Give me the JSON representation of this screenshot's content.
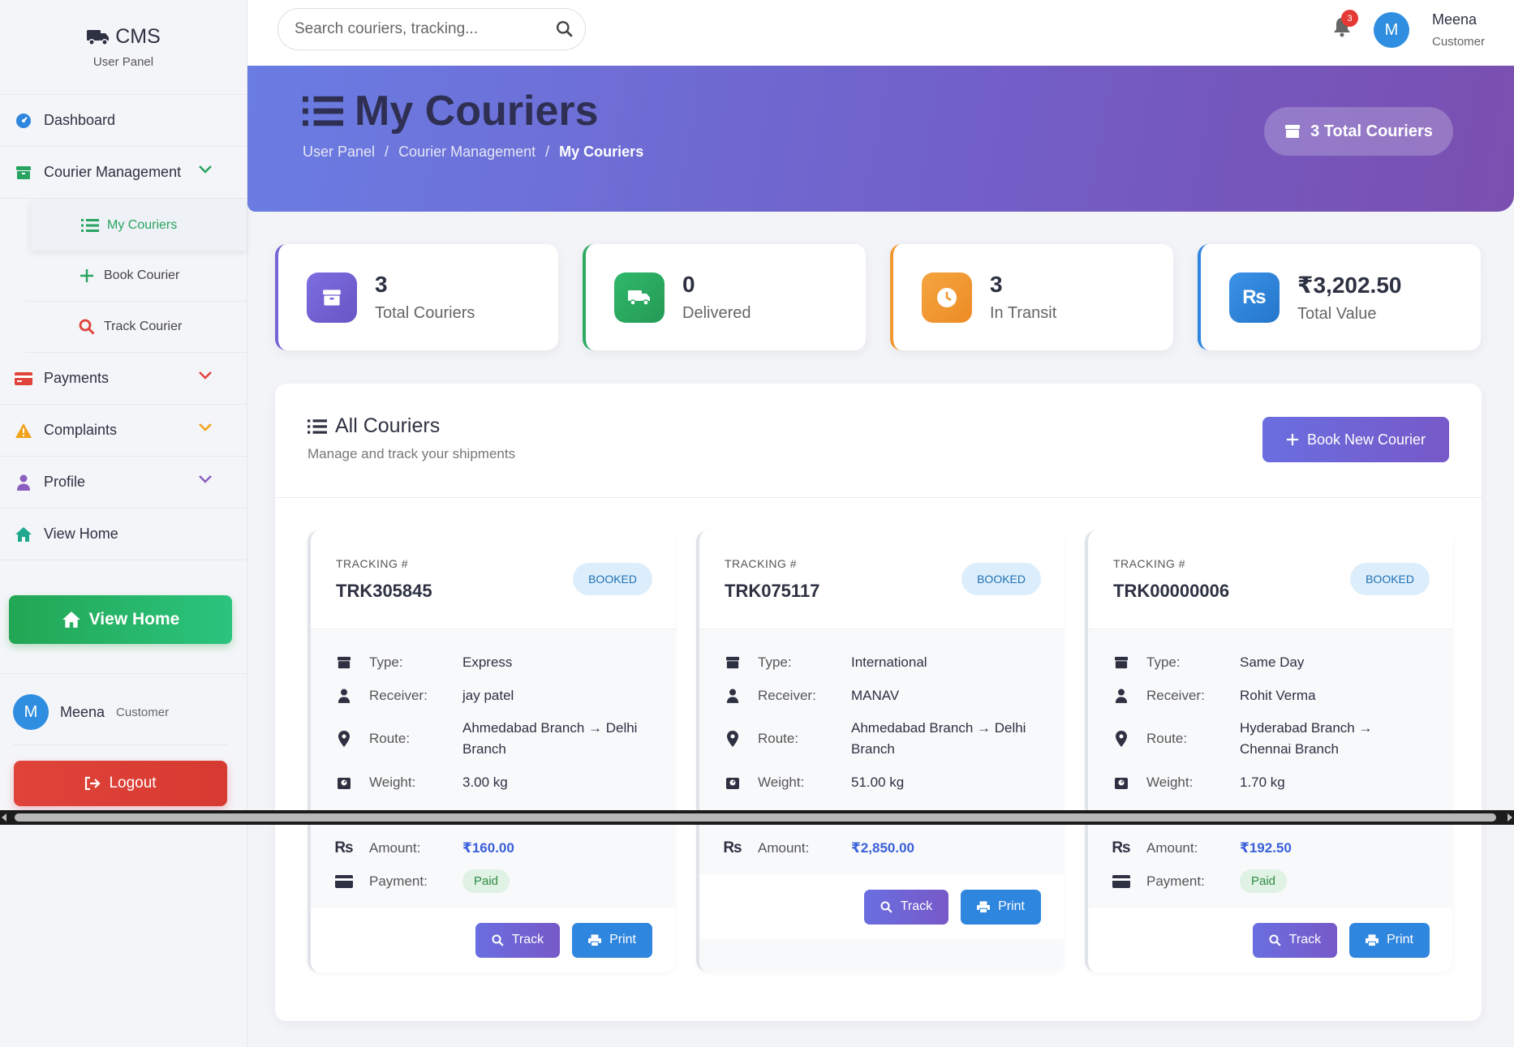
{
  "app": {
    "title": "CMS",
    "subtitle": "User Panel"
  },
  "search": {
    "placeholder": "Search couriers, tracking..."
  },
  "notifications": {
    "count": "3"
  },
  "user": {
    "initial": "M",
    "name": "Meena",
    "role": "Customer"
  },
  "sidebar": {
    "items": [
      {
        "label": "Dashboard"
      },
      {
        "label": "Courier Management"
      },
      {
        "label": "Payments"
      },
      {
        "label": "Complaints"
      },
      {
        "label": "Profile"
      },
      {
        "label": "View Home"
      }
    ],
    "sub_items": [
      {
        "label": "My Couriers"
      },
      {
        "label": "Book Courier"
      },
      {
        "label": "Track Courier"
      }
    ],
    "view_home_button": "View Home",
    "logout_button": "Logout"
  },
  "hero": {
    "title": "My Couriers",
    "breadcrumb": [
      "User Panel",
      "/",
      "Courier Management",
      "/",
      "My Couriers"
    ],
    "total_pill": "3 Total Couriers"
  },
  "stats": [
    {
      "value": "3",
      "label": "Total Couriers",
      "color": "#7466d6"
    },
    {
      "value": "0",
      "label": "Delivered",
      "color": "#2eab62"
    },
    {
      "value": "3",
      "label": "In Transit",
      "color": "#f0982f"
    },
    {
      "value": "₹3,202.50",
      "label": "Total Value",
      "color": "#2f86de"
    }
  ],
  "panel": {
    "title": "All Couriers",
    "subtitle": "Manage and track your shipments",
    "book_button": "Book New Courier"
  },
  "card_labels": {
    "tracking": "TRACKING #",
    "type": "Type:",
    "receiver": "Receiver:",
    "route": "Route:",
    "weight": "Weight:",
    "amount": "Amount:",
    "payment": "Payment:",
    "track": "Track",
    "print": "Print"
  },
  "couriers": [
    {
      "tracking": "TRK305845",
      "status": "BOOKED",
      "type": "Express",
      "receiver": "jay patel",
      "route": "Ahmedabad Branch → Delhi Branch",
      "weight": "3.00 kg",
      "amount": "₹160.00",
      "payment": "Paid"
    },
    {
      "tracking": "TRK075117",
      "status": "BOOKED",
      "type": "International",
      "receiver": "MANAV",
      "route": "Ahmedabad Branch → Delhi Branch",
      "weight": "51.00 kg",
      "amount": "₹2,850.00",
      "payment": ""
    },
    {
      "tracking": "TRK00000006",
      "status": "BOOKED",
      "type": "Same Day",
      "receiver": "Rohit Verma",
      "route": "Hyderabad Branch → Chennai Branch",
      "weight": "1.70 kg",
      "amount": "₹192.50",
      "payment": "Paid"
    }
  ],
  "colors": {
    "accent": "#7466d6",
    "success": "#28a460",
    "danger": "#e0433a",
    "primary": "#2f86de"
  }
}
